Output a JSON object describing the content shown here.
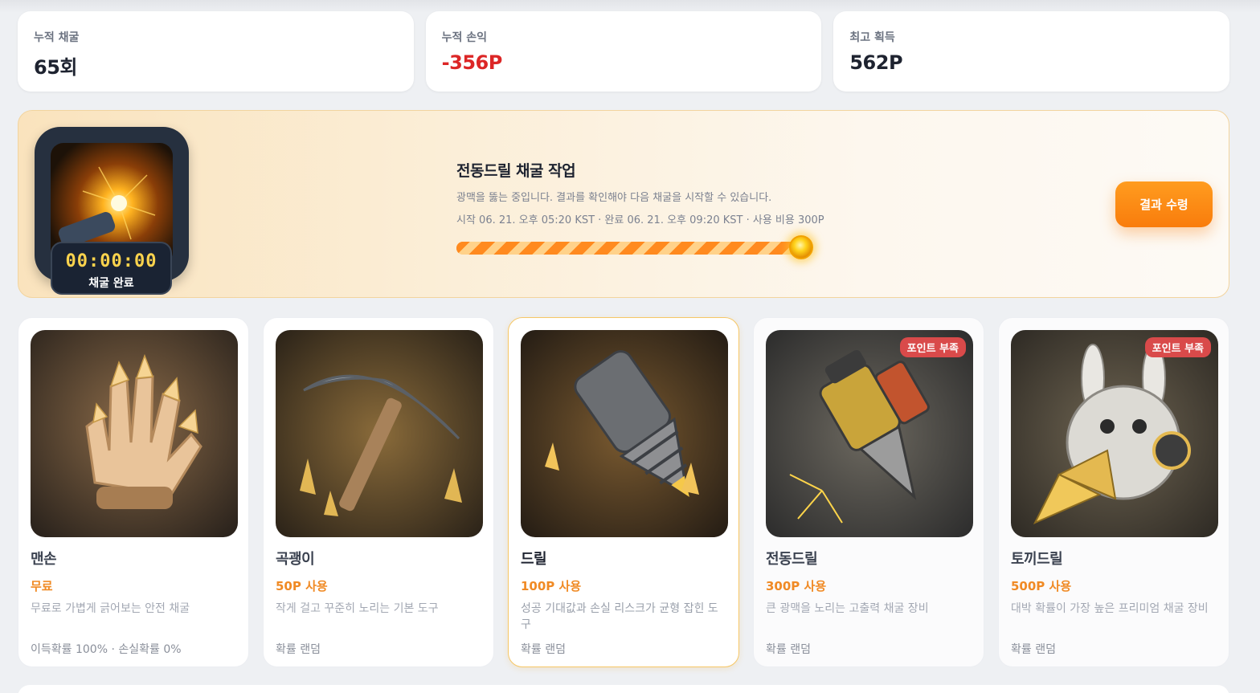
{
  "stats": [
    {
      "label": "누적 채굴",
      "value": "65회",
      "negative": false
    },
    {
      "label": "누적 손익",
      "value": "-356P",
      "negative": true
    },
    {
      "label": "최고 획득",
      "value": "562P",
      "negative": false
    }
  ],
  "job": {
    "timer": "00:00:00",
    "status": "채굴 완료",
    "title": "전동드릴 채굴 작업",
    "description": "광맥을 뚫는 중입니다. 결과를 확인해야 다음 채굴을 시작할 수 있습니다.",
    "meta": "시작 06. 21. 오후 05:20 KST · 완료 06. 21. 오후 09:20 KST · 사용 비용 300P",
    "progress": 1.0,
    "claim_label": "결과 수령"
  },
  "tools": [
    {
      "name": "맨손",
      "cost": "무료",
      "description": "무료로 가볍게 긁어보는 안전 채굴",
      "probability": "이득확률 100% · 손실확률 0%",
      "badge": "",
      "icon": "glove-icon",
      "state": "normal"
    },
    {
      "name": "곡괭이",
      "cost": "50P 사용",
      "description": "작게 걸고 꾸준히 노리는 기본 도구",
      "probability": "확률 랜덤",
      "badge": "",
      "icon": "pickaxe-icon",
      "state": "normal"
    },
    {
      "name": "드릴",
      "cost": "100P 사용",
      "description": "성공 기대값과 손실 리스크가 균형 잡힌 도구",
      "probability": "확률 랜덤",
      "badge": "",
      "icon": "drill-icon",
      "state": "selected"
    },
    {
      "name": "전동드릴",
      "cost": "300P 사용",
      "description": "큰 광맥을 노리는 고출력 채굴 장비",
      "probability": "확률 랜덤",
      "badge": "포인트 부족",
      "icon": "power-drill-icon",
      "state": "dim"
    },
    {
      "name": "토끼드릴",
      "cost": "500P 사용",
      "description": "대박 확률이 가장 높은 프리미엄 채굴 장비",
      "probability": "확률 랜덤",
      "badge": "포인트 부족",
      "icon": "rabbit-drill-icon",
      "state": "dim"
    }
  ],
  "colors": {
    "accent": "#f97c0c",
    "negative": "#dc2626",
    "badge": "#d94a4a"
  }
}
